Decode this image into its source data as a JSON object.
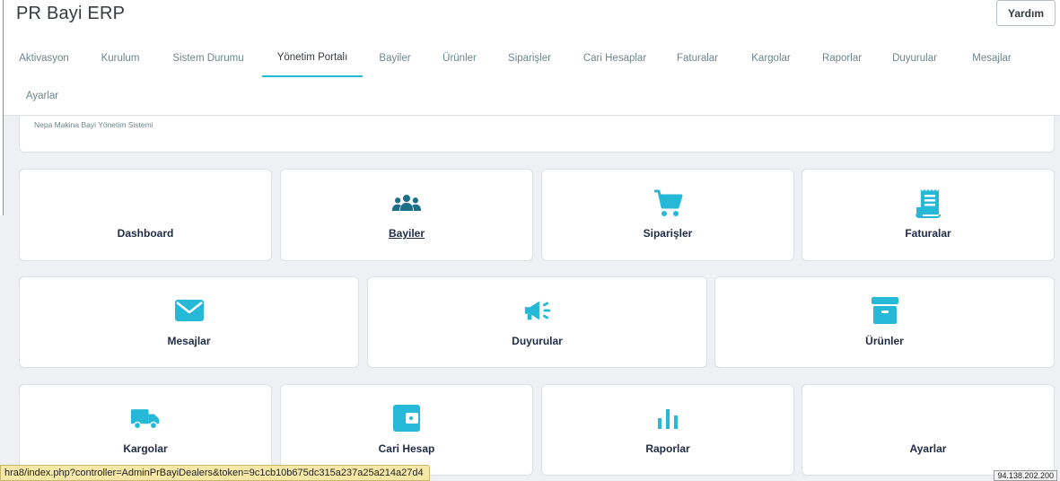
{
  "app": {
    "title": "PR Bayi ERP",
    "help_label": "Yardım"
  },
  "tabs": [
    {
      "label": "Aktivasyon"
    },
    {
      "label": "Kurulum"
    },
    {
      "label": "Sistem Durumu"
    },
    {
      "label": "Yönetim Portalı",
      "active": true
    },
    {
      "label": "Bayiler"
    },
    {
      "label": "Ürünler"
    },
    {
      "label": "Siparişler"
    },
    {
      "label": "Cari Hesaplar"
    },
    {
      "label": "Faturalar"
    },
    {
      "label": "Kargolar"
    },
    {
      "label": "Raporlar"
    },
    {
      "label": "Duyurular"
    },
    {
      "label": "Mesajlar"
    },
    {
      "label": "Ayarlar"
    }
  ],
  "info": {
    "subtitle": "Nepa Makina Bayi Yönetim Sistemi"
  },
  "tiles": [
    {
      "label": "Dashboard",
      "icon": "none"
    },
    {
      "label": "Bayiler",
      "icon": "users-icon"
    },
    {
      "label": "Siparişler",
      "icon": "cart-icon"
    },
    {
      "label": "Faturalar",
      "icon": "receipt-icon"
    },
    {
      "label": "Mesajlar",
      "icon": "envelope-icon"
    },
    {
      "label": "Duyurular",
      "icon": "megaphone-icon"
    },
    {
      "label": "Ürünler",
      "icon": "archive-box-icon"
    },
    {
      "label": "Kargolar",
      "icon": "truck-icon"
    },
    {
      "label": "Cari Hesap",
      "icon": "wallet-icon"
    },
    {
      "label": "Raporlar",
      "icon": "bar-chart-icon"
    },
    {
      "label": "Ayarlar",
      "icon": "none"
    }
  ],
  "colors": {
    "accent": "#25b9d7",
    "icon_dark": "#1d6f87",
    "tile_text": "#1f2a44"
  },
  "statusbar": {
    "url": "hra8/index.php?controller=AdminPrBayiDealers&token=9c1cb10b675dc315a237a25a214a27d4"
  },
  "ip": {
    "address": "94.138.202.200"
  }
}
